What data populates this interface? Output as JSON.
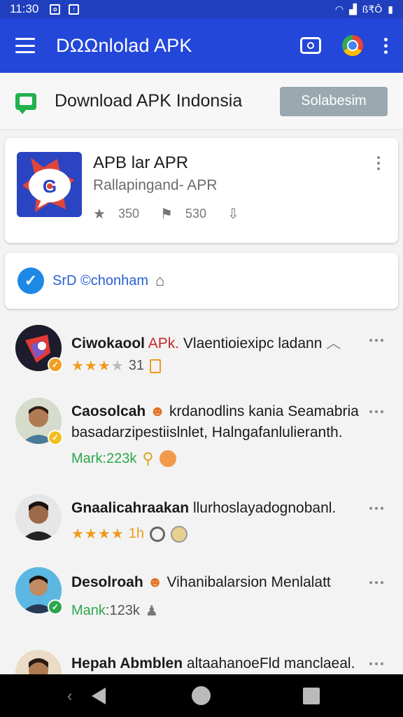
{
  "status_bar": {
    "time": "11:30",
    "carrier": "ß₹Ô"
  },
  "app_bar": {
    "title": "DΩΩnlolad APK"
  },
  "subheader": {
    "title": "Download APK Indonsia",
    "button": "Solabesim"
  },
  "app_card": {
    "title": "APB lar APR",
    "subtitle": "Rallapingand- APR",
    "stat1": "350",
    "stat2": "530"
  },
  "link_card": {
    "text": "SrD ©chonham"
  },
  "items": [
    {
      "title_bold": "Ciwokaool",
      "title_red": "APk.",
      "title_rest": "Vlaentioiexipc ladann",
      "rating_num": "31"
    },
    {
      "title_bold": "Caosolcah",
      "title_rest": "krdanodlins kania Seamabria",
      "line2": "basadarzipestiislnlet, Halngafanlulieranth.",
      "meta_green": "Mark",
      "meta_num": ":223k"
    },
    {
      "title_bold": "Gnaalicahraakan",
      "title_rest": "llurhoslayadognobanl.",
      "rating_num": "1h"
    },
    {
      "title_bold": "Desolroah",
      "title_rest": "Vihanibalarsion Menlalatt",
      "meta_green": "Mank",
      "meta_num": ":123k"
    },
    {
      "title_bold": "Hepah Abmblen",
      "title_rest": "altaahanoeFld manclaeal."
    }
  ],
  "colors": {
    "primary": "#2347d8",
    "status": "#1f3fbf",
    "accent_green": "#22b14c",
    "star": "#f09a1c"
  }
}
